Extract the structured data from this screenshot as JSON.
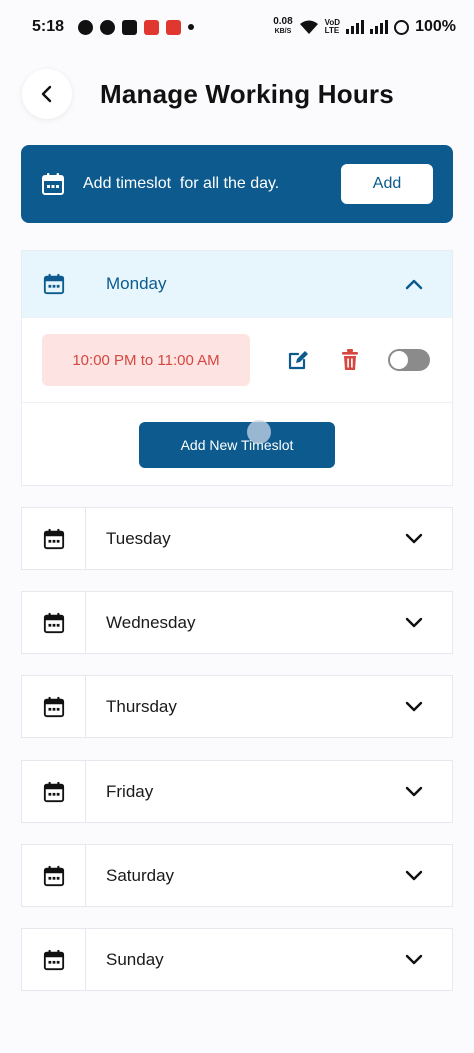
{
  "status_bar": {
    "time": "5:18",
    "speed_value": "0.08",
    "speed_unit": "KB/S",
    "volte_top": "VoD",
    "volte_bottom": "LTE",
    "battery": "100%"
  },
  "header": {
    "title": "Manage Working Hours"
  },
  "all_day": {
    "text": "Add timeslot  for all the day.",
    "add_label": "Add"
  },
  "monday": {
    "label": "Monday",
    "slot_text": "10:00 PM to 11:00 AM",
    "slot_enabled": false,
    "add_slot_label": "Add New Timeslot"
  },
  "days": [
    {
      "label": "Tuesday"
    },
    {
      "label": "Wednesday"
    },
    {
      "label": "Thursday"
    },
    {
      "label": "Friday"
    },
    {
      "label": "Saturday"
    },
    {
      "label": "Sunday"
    }
  ],
  "colors": {
    "primary": "#0c5a8e",
    "slot_bg": "#fde4e2",
    "slot_text": "#d64740",
    "delete_icon": "#d64740",
    "open_header_bg": "#e6f6fc"
  },
  "icons": {
    "back": "chevron-left-icon",
    "calendar": "calendar-icon",
    "expand": "chevron-down-icon",
    "collapse": "chevron-up-icon",
    "edit": "edit-icon",
    "delete": "trash-icon"
  }
}
